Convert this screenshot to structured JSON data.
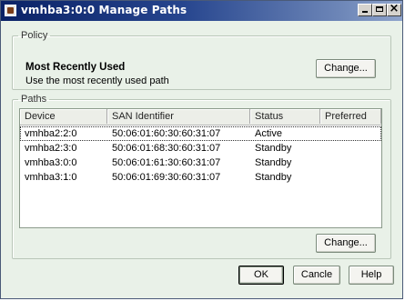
{
  "window": {
    "title": "vmhba3:0:0 Manage Paths",
    "controls": [
      "minimize-icon",
      "maximize-icon",
      "close-icon"
    ]
  },
  "policy": {
    "legend": "Policy",
    "name": "Most Recently Used",
    "description": "Use the most recently used path",
    "change_label": "Change..."
  },
  "paths": {
    "legend": "Paths",
    "columns": [
      "Device",
      "SAN Identifier",
      "Status",
      "Preferred"
    ],
    "rows": [
      {
        "device": "vmhba2:2:0",
        "san": "50:06:01:60:30:60:31:07",
        "status": "Active",
        "preferred": ""
      },
      {
        "device": "vmhba2:3:0",
        "san": "50:06:01:68:30:60:31:07",
        "status": "Standby",
        "preferred": ""
      },
      {
        "device": "vmhba3:0:0",
        "san": "50:06:01:61:30:60:31:07",
        "status": "Standby",
        "preferred": ""
      },
      {
        "device": "vmhba3:1:0",
        "san": "50:06:01:69:30:60:31:07",
        "status": "Standby",
        "preferred": ""
      }
    ],
    "change_label": "Change..."
  },
  "footer": {
    "ok": "OK",
    "cancel": "Cancle",
    "help": "Help"
  }
}
